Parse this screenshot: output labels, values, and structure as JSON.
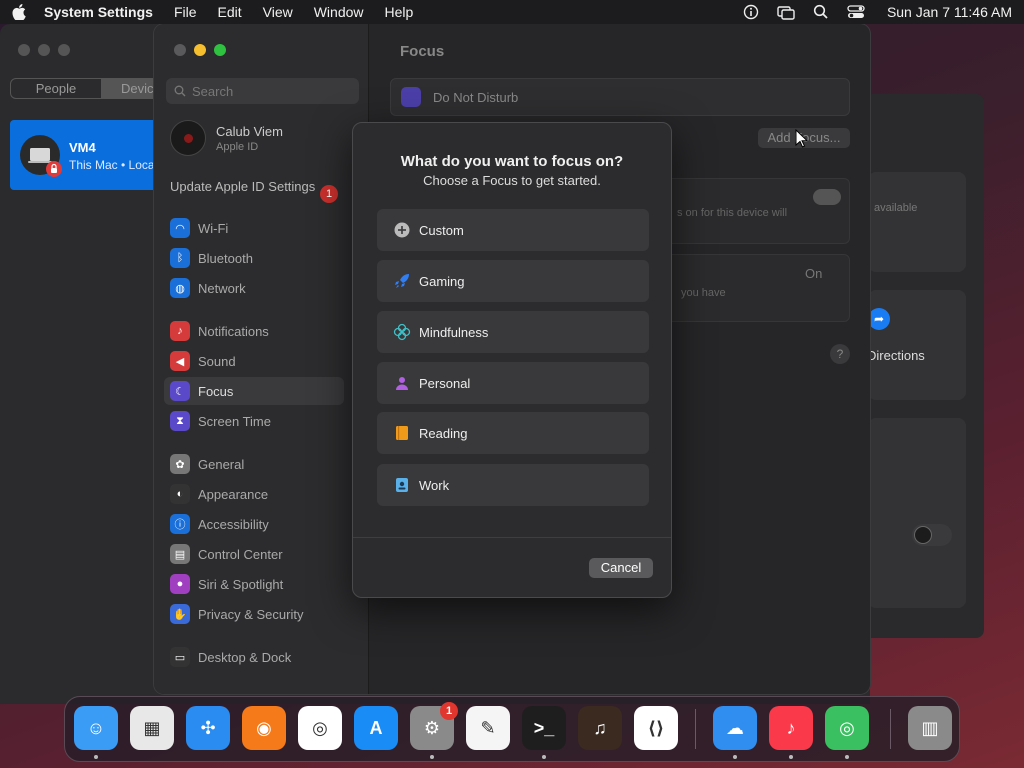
{
  "menubar": {
    "app_name": "System Settings",
    "items": [
      "File",
      "Edit",
      "View",
      "Window",
      "Help"
    ],
    "clock": "Sun Jan 7  11:46 AM"
  },
  "background_window": {
    "segments": [
      "People",
      "Devic"
    ],
    "device_name": "VM4",
    "device_subtitle": "This Mac • Loca"
  },
  "right_panel": {
    "available_text": "available",
    "directions_label": "Directions"
  },
  "settings": {
    "search_placeholder": "Search",
    "account_name": "Calub Viem",
    "account_sub": "Apple ID",
    "update_label": "Update Apple ID Settings",
    "update_badge": "1",
    "sidebar_items": [
      {
        "label": "Wi-Fi",
        "icon": "wifi-icon",
        "color": "#1a6fd8"
      },
      {
        "label": "Bluetooth",
        "icon": "bluetooth-icon",
        "color": "#1a6fd8"
      },
      {
        "label": "Network",
        "icon": "globe-icon",
        "color": "#1a6fd8"
      },
      {
        "label": "Notifications",
        "icon": "bell-icon",
        "color": "#d63b3b"
      },
      {
        "label": "Sound",
        "icon": "speaker-icon",
        "color": "#d63b3b"
      },
      {
        "label": "Focus",
        "icon": "moon-icon",
        "color": "#5a49c9"
      },
      {
        "label": "Screen Time",
        "icon": "hourglass-icon",
        "color": "#5a49c9"
      },
      {
        "label": "General",
        "icon": "gear-icon",
        "color": "#777"
      },
      {
        "label": "Appearance",
        "icon": "appearance-icon",
        "color": "#333"
      },
      {
        "label": "Accessibility",
        "icon": "accessibility-icon",
        "color": "#1a6fd8"
      },
      {
        "label": "Control Center",
        "icon": "control-center-icon",
        "color": "#777"
      },
      {
        "label": "Siri & Spotlight",
        "icon": "siri-icon",
        "color": "#a040c0"
      },
      {
        "label": "Privacy & Security",
        "icon": "hand-icon",
        "color": "#3a6ad8"
      },
      {
        "label": "Desktop & Dock",
        "icon": "dock-icon",
        "color": "#333"
      }
    ],
    "content_title": "Focus",
    "dnd_label": "Do Not Disturb",
    "add_focus_label": "Add Focus...",
    "share_text": "s on for this device will",
    "status_on": "On",
    "status_text": "you have",
    "help_label": "?"
  },
  "modal": {
    "title": "What do you want to focus on?",
    "subtitle": "Choose a Focus to get started.",
    "options": [
      {
        "label": "Custom",
        "icon": "plus-circle-icon",
        "color": "#bbbbbb"
      },
      {
        "label": "Gaming",
        "icon": "rocket-icon",
        "color": "#2f7ef5"
      },
      {
        "label": "Mindfulness",
        "icon": "flower-icon",
        "color": "#3fc0c8"
      },
      {
        "label": "Personal",
        "icon": "person-icon",
        "color": "#b060e0"
      },
      {
        "label": "Reading",
        "icon": "book-icon",
        "color": "#f09a1a"
      },
      {
        "label": "Work",
        "icon": "badge-icon",
        "color": "#5ab0e8"
      }
    ],
    "cancel_label": "Cancel"
  },
  "dock": {
    "apps": [
      {
        "name": "Finder",
        "icon": "finder-icon",
        "color": "#3b9cf5"
      },
      {
        "name": "Launchpad",
        "icon": "launchpad-icon",
        "color": "#e8e8e8"
      },
      {
        "name": "Safari",
        "icon": "safari-icon",
        "color": "#2a8cf0"
      },
      {
        "name": "Firefox",
        "icon": "firefox-icon",
        "color": "#f57a1a"
      },
      {
        "name": "Chrome",
        "icon": "chrome-icon",
        "color": "#ffffff"
      },
      {
        "name": "App Store",
        "icon": "app-store-icon",
        "color": "#1a8cf5"
      },
      {
        "name": "System Settings",
        "icon": "settings-icon",
        "color": "#8a8a8a",
        "badge": "1"
      },
      {
        "name": "TextEdit",
        "icon": "textedit-icon",
        "color": "#f5f5f5"
      },
      {
        "name": "Terminal",
        "icon": "terminal-icon",
        "color": "#1e1e1e"
      },
      {
        "name": "GarageBand",
        "icon": "guitar-icon",
        "color": "#3a2a20"
      },
      {
        "name": "VS Code",
        "icon": "vscode-icon",
        "color": "#ffffff"
      },
      {
        "name": "Weather",
        "icon": "weather-icon",
        "color": "#2f8ef0"
      },
      {
        "name": "Music",
        "icon": "music-icon",
        "color": "#fa3a4a"
      },
      {
        "name": "Find My",
        "icon": "findmy-icon",
        "color": "#3ac060"
      },
      {
        "name": "Trash",
        "icon": "trash-icon",
        "color": "#8a8a8a"
      }
    ]
  }
}
